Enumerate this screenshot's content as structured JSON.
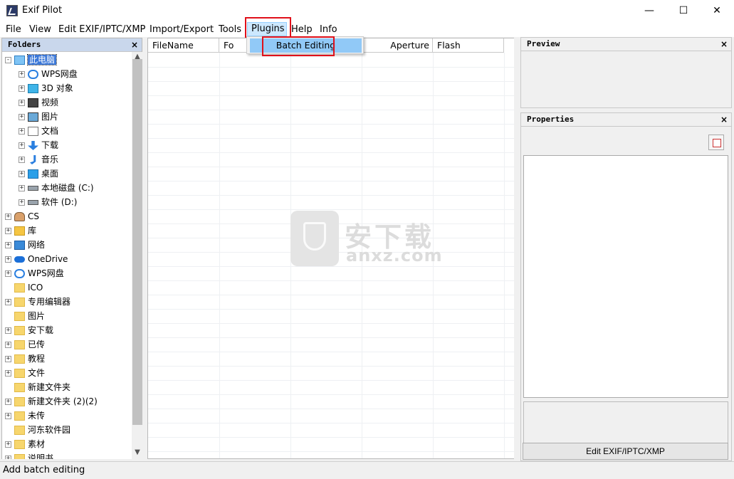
{
  "window": {
    "title": "Exif Pilot",
    "minimize": "—",
    "maximize": "☐",
    "close": "✕"
  },
  "menu": [
    "File",
    "View",
    "Edit EXIF/IPTC/XMP",
    "Import/Export",
    "Tools",
    "Plugins",
    "Help",
    "Info"
  ],
  "dropdown": {
    "item": "Batch Editing"
  },
  "folders": {
    "title": "Folders",
    "close": "×",
    "tree": [
      {
        "label": "此电脑",
        "level": 0,
        "exp": "-",
        "icon": "computer-icon",
        "selected": true
      },
      {
        "label": "WPS网盘",
        "level": 1,
        "exp": "+",
        "icon": "cloud-icon"
      },
      {
        "label": "3D 对象",
        "level": 1,
        "exp": "+",
        "icon": "cube-icon"
      },
      {
        "label": "视频",
        "level": 1,
        "exp": "+",
        "icon": "film-icon"
      },
      {
        "label": "图片",
        "level": 1,
        "exp": "+",
        "icon": "picture-icon"
      },
      {
        "label": "文档",
        "level": 1,
        "exp": "+",
        "icon": "document-icon"
      },
      {
        "label": "下载",
        "level": 1,
        "exp": "+",
        "icon": "download-arrow-icon"
      },
      {
        "label": "音乐",
        "level": 1,
        "exp": "+",
        "icon": "music-note-icon"
      },
      {
        "label": "桌面",
        "level": 1,
        "exp": "+",
        "icon": "desktop-icon"
      },
      {
        "label": "本地磁盘 (C:)",
        "level": 1,
        "exp": "+",
        "icon": "drive-icon"
      },
      {
        "label": "软件 (D:)",
        "level": 1,
        "exp": "+",
        "icon": "drive-icon"
      },
      {
        "label": "CS",
        "level": 0,
        "exp": "+",
        "icon": "user-icon"
      },
      {
        "label": "库",
        "level": 0,
        "exp": "+",
        "icon": "library-icon"
      },
      {
        "label": "网络",
        "level": 0,
        "exp": "+",
        "icon": "network-icon"
      },
      {
        "label": "OneDrive",
        "level": 0,
        "exp": "+",
        "icon": "onedrive-cloud-icon"
      },
      {
        "label": "WPS网盘",
        "level": 0,
        "exp": "+",
        "icon": "cloud-icon"
      },
      {
        "label": "ICO",
        "level": 0,
        "exp": "",
        "icon": "folder-icon"
      },
      {
        "label": "专用编辑器",
        "level": 0,
        "exp": "+",
        "icon": "folder-icon"
      },
      {
        "label": "图片",
        "level": 0,
        "exp": "",
        "icon": "folder-icon"
      },
      {
        "label": "安下载",
        "level": 0,
        "exp": "+",
        "icon": "folder-icon"
      },
      {
        "label": "已传",
        "level": 0,
        "exp": "+",
        "icon": "folder-icon"
      },
      {
        "label": "教程",
        "level": 0,
        "exp": "+",
        "icon": "folder-icon"
      },
      {
        "label": "文件",
        "level": 0,
        "exp": "+",
        "icon": "folder-icon"
      },
      {
        "label": "新建文件夹",
        "level": 0,
        "exp": "",
        "icon": "folder-icon"
      },
      {
        "label": "新建文件夹 (2)(2)",
        "level": 0,
        "exp": "+",
        "icon": "folder-icon"
      },
      {
        "label": "未传",
        "level": 0,
        "exp": "+",
        "icon": "folder-icon"
      },
      {
        "label": "河东软件园",
        "level": 0,
        "exp": "",
        "icon": "folder-icon"
      },
      {
        "label": "素材",
        "level": 0,
        "exp": "+",
        "icon": "folder-icon"
      },
      {
        "label": "说明书",
        "level": 0,
        "exp": "+",
        "icon": "folder-icon"
      }
    ]
  },
  "grid": {
    "columns": [
      "FileName",
      "Fo",
      "",
      "Aperture",
      "Flash"
    ]
  },
  "preview": {
    "title": "Preview",
    "close": "×"
  },
  "properties": {
    "title": "Properties",
    "close": "×",
    "edit_button": "Edit EXIF/IPTC/XMP"
  },
  "status": "Add batch editing",
  "watermark": {
    "text": "安下载",
    "sub": "anxz.com"
  },
  "colors": {
    "highlight_box": "#e0101a",
    "menu_hover": "#91c9f7",
    "selection": "#3b78d8"
  }
}
